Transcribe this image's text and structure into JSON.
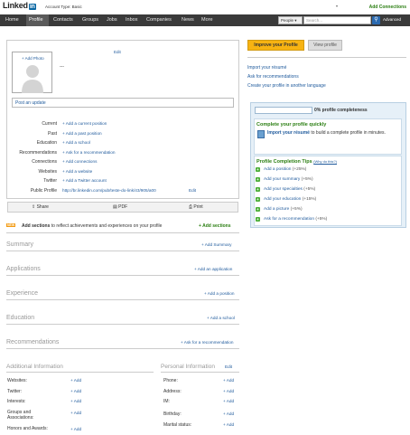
{
  "header": {
    "logo_text": "Linked",
    "logo_in": "in",
    "account_type": "Account Type: Basic",
    "add_connections": "Add Connections",
    "nav": [
      "Home",
      "Profile",
      "Contacts",
      "Groups",
      "Jobs",
      "Inbox",
      "Companies",
      "News",
      "More"
    ],
    "people_label": "People",
    "search_placeholder": "Search...",
    "advanced": "Advanced"
  },
  "profile": {
    "add_photo": "+ Add Photo",
    "edit": "Edit",
    "name_placeholder": "---",
    "post_update": "Post an update",
    "fields": [
      {
        "label": "Current",
        "value": "+ Add a current position"
      },
      {
        "label": "Past",
        "value": "+ Add a past position"
      },
      {
        "label": "Education",
        "value": "+ Add a school"
      },
      {
        "label": "Recommendations",
        "value": "+ Ask for a recommendation"
      },
      {
        "label": "Connections",
        "value": "+ Add connections"
      },
      {
        "label": "Websites",
        "value": "+ Add a website"
      },
      {
        "label": "Twitter",
        "value": "+ Add a Twitter account"
      },
      {
        "label": "Public Profile",
        "value": "http://br.linkedin.com/pub/teste-do-link/43/905/a00"
      }
    ],
    "public_edit": "Edit",
    "share": "Share",
    "pdf": "PDF",
    "print": "Print"
  },
  "new_sections": {
    "badge": "NEW",
    "text": "Add sections to reflect achievements and experiences on your profile",
    "link": "Add sections"
  },
  "sections": [
    {
      "title": "Summary",
      "link": "+ Add Summary"
    },
    {
      "title": "Applications",
      "link": "+ Add an application"
    },
    {
      "title": "Experience",
      "link": "+ Add a position"
    },
    {
      "title": "Education",
      "link": "+ Add a school"
    },
    {
      "title": "Recommendations",
      "link": "+ Ask for a recommendation"
    }
  ],
  "additional_info": {
    "title": "Additional Information",
    "rows": [
      {
        "label": "Websites:",
        "add": "+ Add"
      },
      {
        "label": "Twitter:",
        "add": "+ Add"
      },
      {
        "label": "Interests:",
        "add": "+ Add"
      },
      {
        "label": "Groups and Associations:",
        "add": "+ Add"
      },
      {
        "label": "Honors and Awards:",
        "add": "+ Add"
      }
    ]
  },
  "personal_info": {
    "title": "Personal Information",
    "edit": "Edit",
    "rows": [
      {
        "label": "Phone:",
        "add": "+ Add"
      },
      {
        "label": "Address:",
        "add": "+ Add"
      },
      {
        "label": "IM:",
        "add": "+ Add"
      },
      {
        "label": "Birthday:",
        "add": "+ Add"
      },
      {
        "label": "Marital status:",
        "add": "+ Add"
      }
    ]
  },
  "right": {
    "improve_button": "Improve your Profile",
    "view_button": "View profile",
    "links": [
      "Import your résumé",
      "Ask for recommendations",
      "Create your profile in another language"
    ],
    "completeness_value": 0,
    "completeness_text": "0% profile completeness",
    "complete_title": "Complete your profile quickly",
    "import_link": "Import your résumé",
    "import_rest": "to build a complete profile in minutes.",
    "tips_title": "Profile Completion Tips",
    "tips_why": "(Why do this?)",
    "tips": [
      {
        "text": "Add a position",
        "bonus": "(+25%)"
      },
      {
        "text": "Add your summary",
        "bonus": "(+5%)"
      },
      {
        "text": "Add your specialties",
        "bonus": "(+5%)"
      },
      {
        "text": "Add your education",
        "bonus": "(+15%)"
      },
      {
        "text": "Add a picture",
        "bonus": "(+5%)"
      },
      {
        "text": "Ask for a recommendation",
        "bonus": "(+5%)"
      }
    ]
  }
}
